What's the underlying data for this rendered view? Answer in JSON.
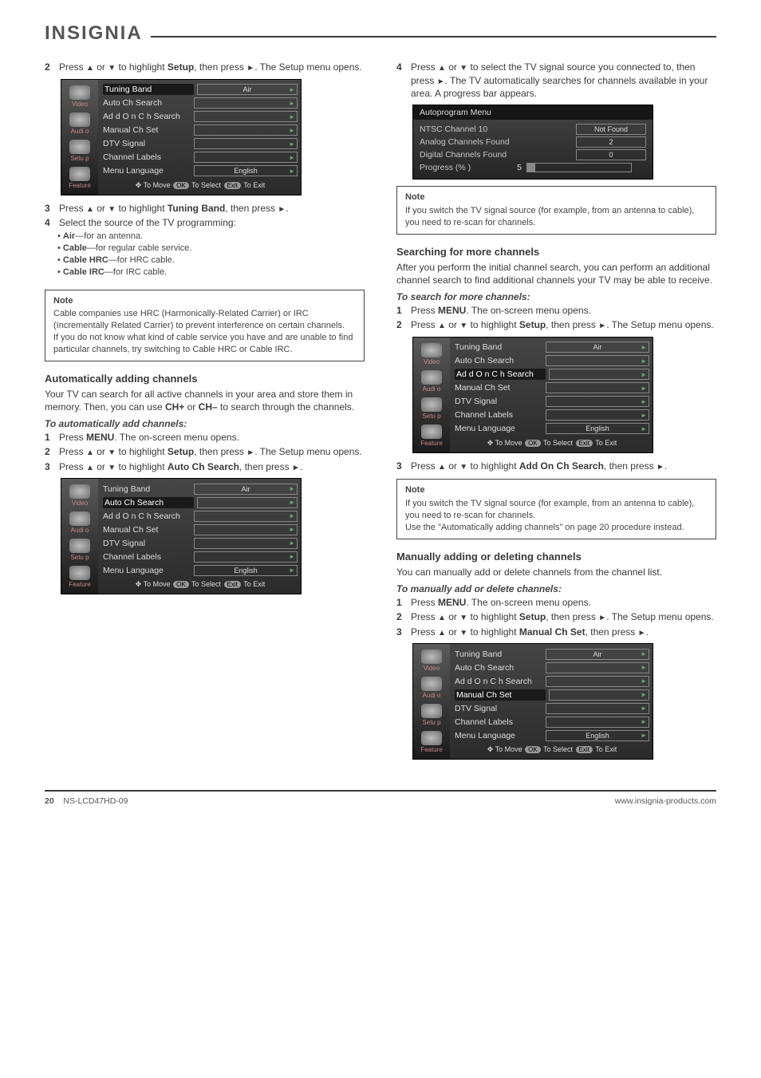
{
  "logo": "INSIGNIA",
  "arrows": {
    "up": "▲",
    "down": "▼",
    "right": "►",
    "nav": "✥"
  },
  "left": {
    "step2": {
      "num": "2",
      "text_a": "Press ",
      "text_b": " or ",
      "text_c": " to highlight ",
      "setup": "Setup",
      "text_d": ", then press ",
      "text_e": ". The Setup menu opens."
    },
    "step3": {
      "num": "3",
      "text_a": "Press ",
      "text_b": " or ",
      "text_c": " to highlight ",
      "tuning": "Tuning Band",
      "text_d": ", then press ",
      "text_e": "."
    },
    "step4a": {
      "num": "4",
      "text": "Select the source of the TV programming:"
    },
    "bullet_air": {
      "label": "Air",
      "text": "—for an antenna."
    },
    "bullet_cable": {
      "label": "Cable",
      "text": "—for regular cable service."
    },
    "bullet_hrc": {
      "label": "Cable HRC",
      "text": "—for HRC cable."
    },
    "bullet_irc": {
      "label": "Cable IRC",
      "text": "—for IRC cable."
    },
    "note_top": {
      "title": "Note",
      "l1": "Cable companies use HRC (Harmonically-Related Carrier) or IRC (Incrementally Related Carrier) to prevent interference on certain channels.",
      "l2": "If you do not know what kind of cable service you have and are unable to find particular channels, try switching to Cable HRC or Cable IRC."
    },
    "h_auto": "Automatically adding channels",
    "auto_p1": "Your TV can search for all active channels in your area and store them in memory. Then, you can use ",
    "chup": "CH+",
    "auto_or": " or ",
    "chdn": "CH–",
    "auto_p2": " to search through the channels.",
    "to_add": "To automatically add channels:",
    "auto_s1": {
      "num": "1",
      "text_a": "Press ",
      "menu": "MENU",
      "text_b": ". The on-screen menu opens."
    },
    "auto_s2": {
      "num": "2",
      "text_a": "Press ",
      "text_b": " or ",
      "text_c": " to highlight ",
      "setup": "Setup",
      "text_d": ", then press ",
      "text_e": ". The Setup menu opens."
    },
    "auto_s3": {
      "num": "3",
      "text_a": "Press ",
      "text_b": " or ",
      "text_c": " to highlight ",
      "sel": "Auto Ch Search",
      "text_d": ", then press ",
      "text_e": "."
    }
  },
  "right": {
    "step4b": {
      "num": "4",
      "text_a": "Press ",
      "text_b": " or ",
      "text_c": " to select the TV signal source you connected to, then press ",
      "text_d": ". The TV automatically searches for channels available in your area. A progress bar appears."
    },
    "autop": {
      "title": "Autoprogram   Menu",
      "r1": "NTSC   Channel   10",
      "v1": "Not Found",
      "r2": "Analog  Channels   Found",
      "v2": "2",
      "r3": "Digital  Channels   Found",
      "v3": "0",
      "r4a": "Progress   (% )",
      "r4b": "5"
    },
    "note_mid": {
      "title": "Note",
      "text": "If you switch the TV signal source (for example, from an antenna to cable), you need to re-scan for channels."
    },
    "h_addon": "Searching for more channels",
    "addon_p": "After you perform the initial channel search, you can perform an additional channel search to find additional channels your TV may be able to receive.",
    "addon_to": "To search for more channels:",
    "addon_s1": {
      "num": "1",
      "text_a": "Press ",
      "menu": "MENU",
      "text_b": ". The on-screen menu opens."
    },
    "addon_s2": {
      "num": "2",
      "text_a": "Press ",
      "text_b": " or ",
      "text_c": " to highlight ",
      "setup": "Setup",
      "text_d": ", then press ",
      "text_e": ". The Setup menu opens."
    },
    "addon_s3": {
      "num": "3",
      "text_a": "Press ",
      "text_b": " or ",
      "text_c": " to highlight ",
      "sel": "Add On Ch Search",
      "text_d": ", then press ",
      "text_e": "."
    },
    "note_bot": {
      "title": "Note",
      "l1": "If you switch the TV signal source (for example, from an antenna to cable), you need to re-scan for channels.",
      "l2": "Use the \"Automatically adding channels\" on page 20 procedure instead."
    },
    "h_manual": "Manually adding or deleting channels",
    "manual_p": "You can manually add or delete channels from the channel list.",
    "manual_to": "To manually add or delete channels:",
    "manual_s1": {
      "num": "1",
      "text_a": "Press ",
      "menu": "MENU",
      "text_b": ". The on-screen menu opens."
    },
    "manual_s2": {
      "num": "2",
      "text_a": "Press ",
      "text_b": " or ",
      "text_c": " to highlight ",
      "setup": "Setup",
      "text_d": ", then press ",
      "text_e": ". The Setup menu opens."
    },
    "manual_s3": {
      "num": "3",
      "text_a": "Press ",
      "text_b": " or ",
      "text_c": " to highlight ",
      "sel": "Manual Ch Set",
      "text_d": ", then press ",
      "text_e": "."
    }
  },
  "menu": {
    "rows": [
      {
        "label": "Tuning  Band",
        "val": "Air"
      },
      {
        "label": "Auto  Ch   Search",
        "val": ""
      },
      {
        "label": "Ad d  O n  C h  Search",
        "val": ""
      },
      {
        "label": "Manual  Ch  Set",
        "val": ""
      },
      {
        "label": "DTV  Signal",
        "val": ""
      },
      {
        "label": "Channel   Labels",
        "val": ""
      },
      {
        "label": "Menu  Language",
        "val": "English"
      }
    ],
    "side": [
      "Video",
      "Audi o",
      "Setu p",
      "Feature"
    ],
    "hints": {
      "move": "To Move",
      "ok": "OK",
      "select": "To Select",
      "exit": "Exit",
      "toexit": "To Exit"
    }
  },
  "footer": {
    "page": "20",
    "model": "NS-LCD47HD-09",
    "site": "www.insignia-products.com"
  }
}
